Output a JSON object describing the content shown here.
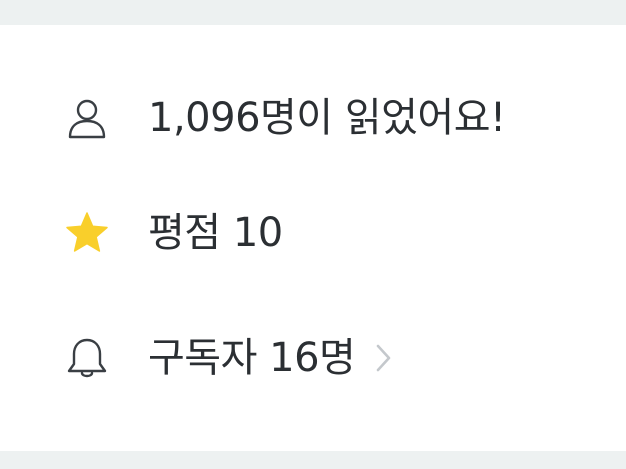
{
  "readers": {
    "icon": "person-icon",
    "text": "1,096명이 읽었어요!"
  },
  "rating": {
    "icon": "star-icon",
    "text": "평점 10",
    "star_color": "#f9cf2b"
  },
  "subscribers": {
    "icon": "bell-icon",
    "text": "구독자 16명",
    "chevron": "chevron-right-icon"
  }
}
